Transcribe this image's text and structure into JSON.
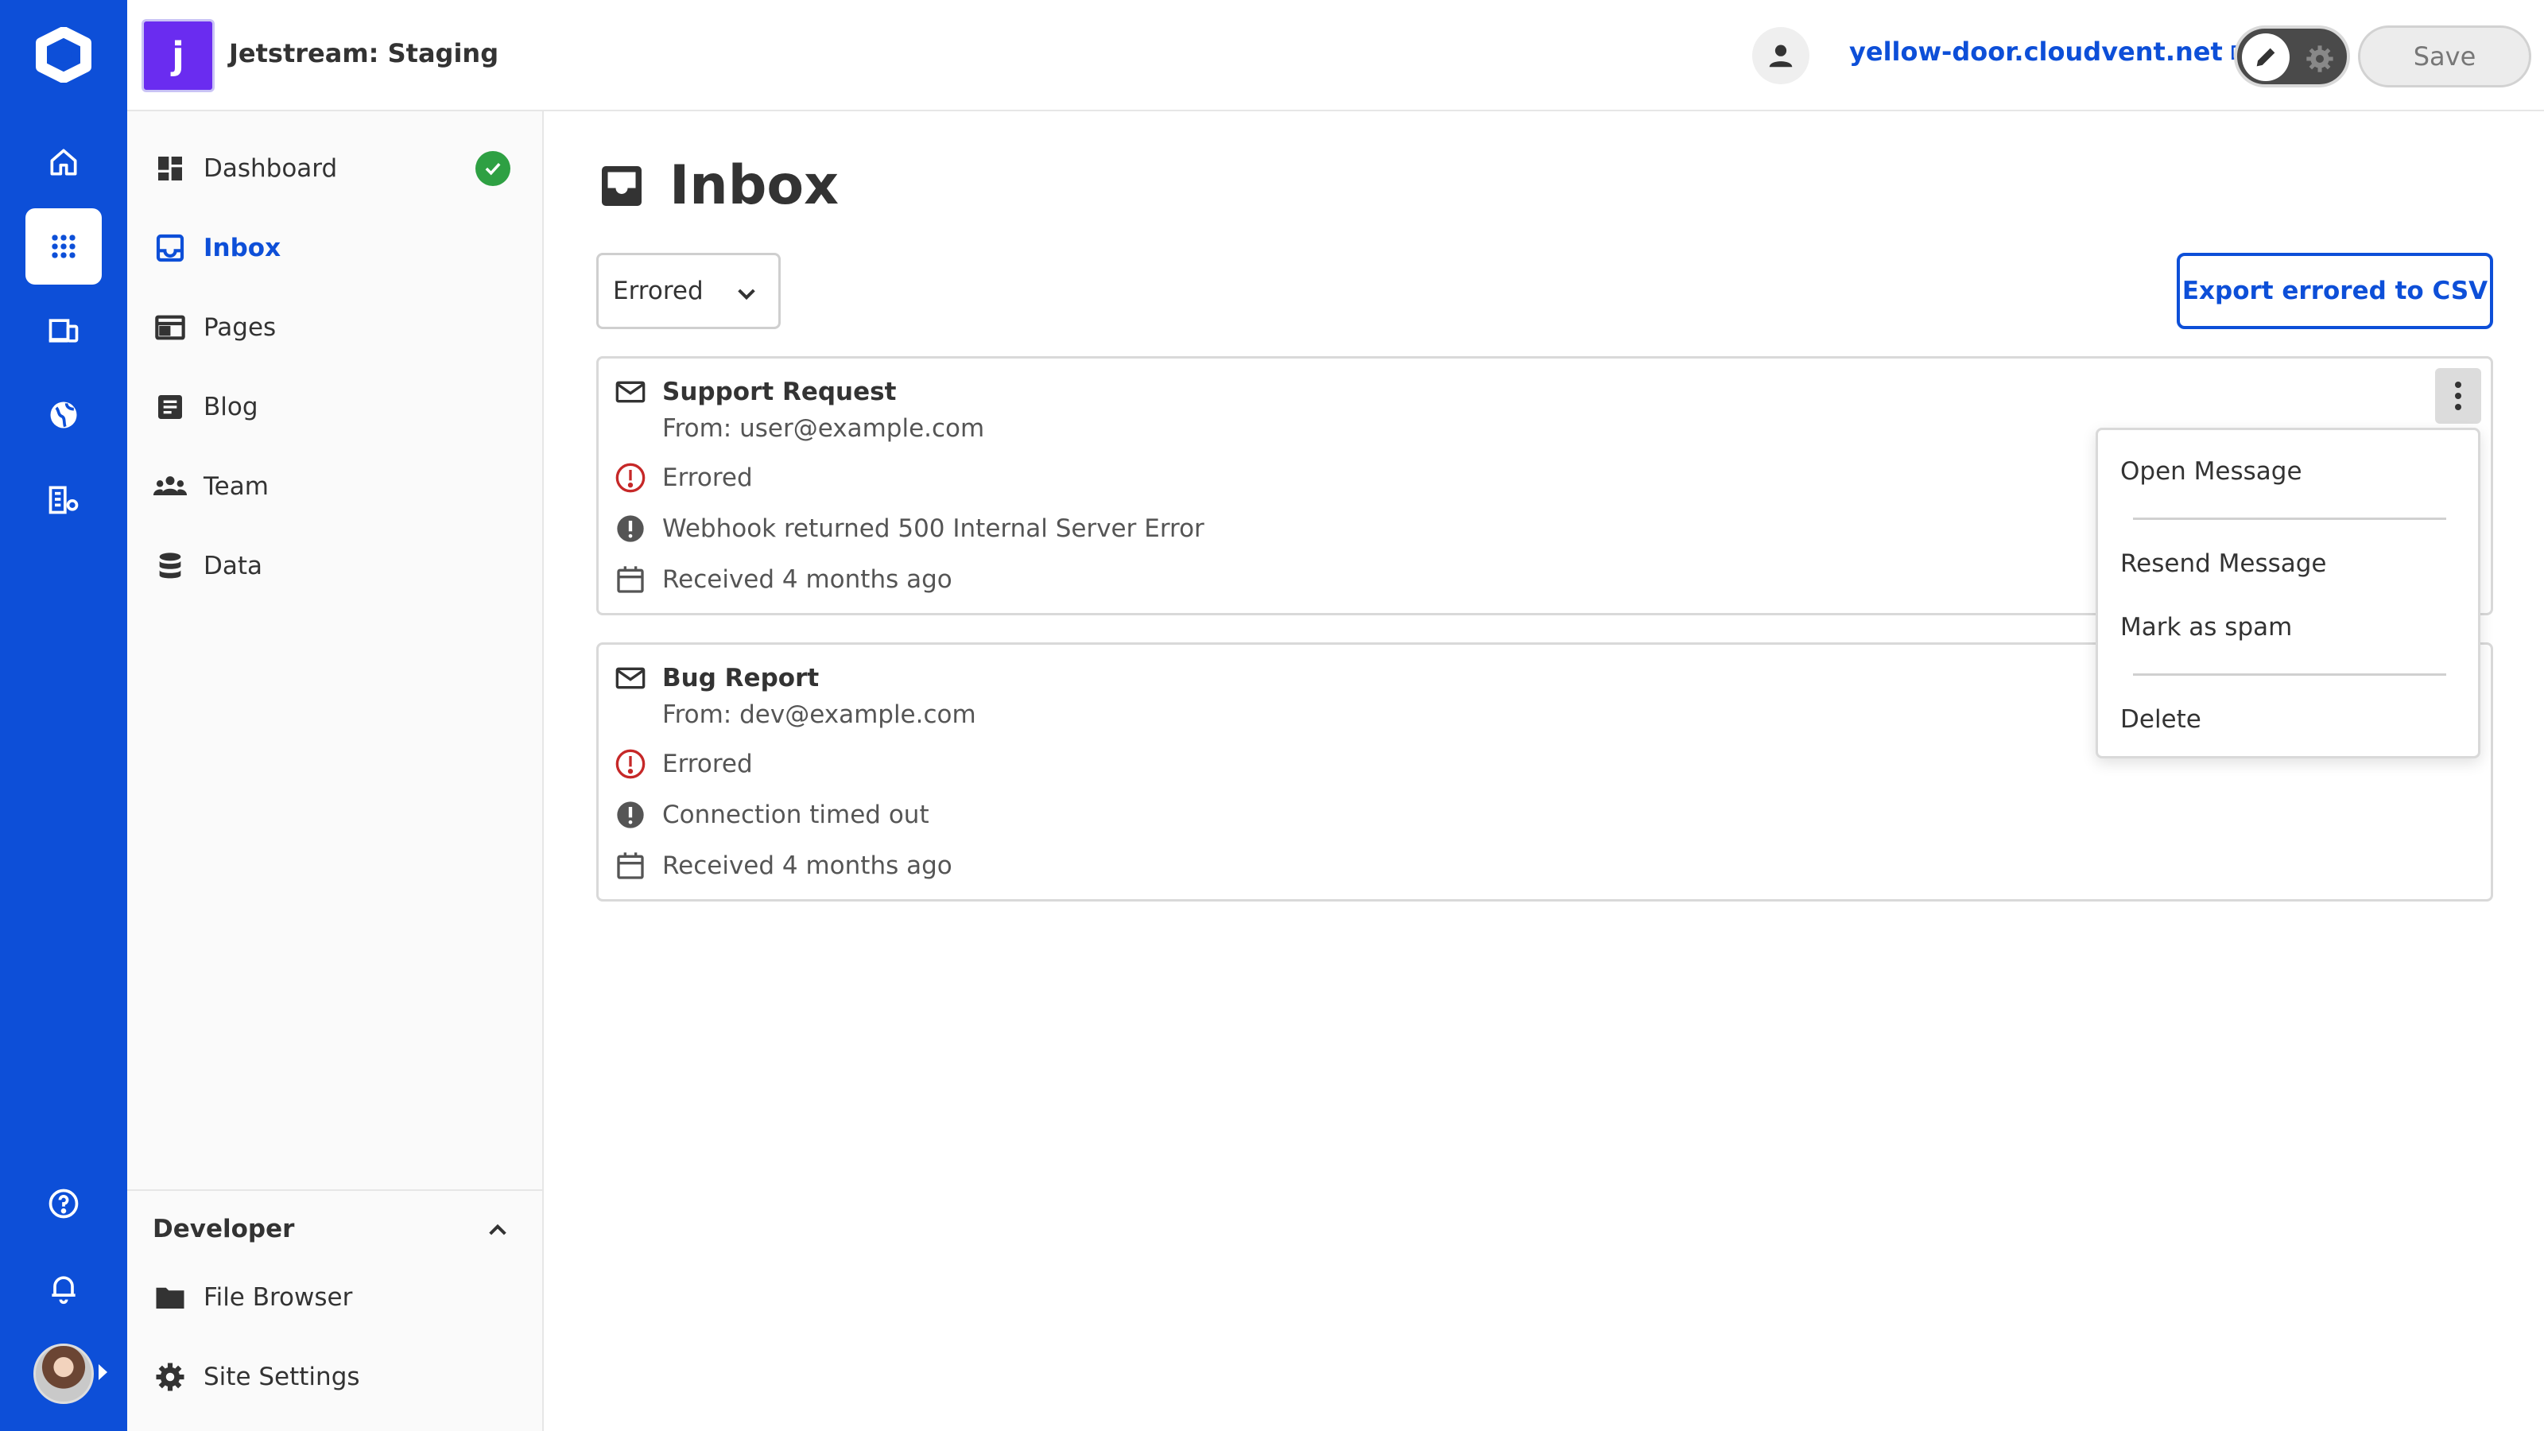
{
  "app": {
    "site_initial": "j",
    "site_name": "Jetstream: Staging",
    "domain": "yellow-door.cloudvent.net",
    "save_label": "Save",
    "accent_color": "#0d4fd8"
  },
  "rail": {
    "items": [
      "home-icon",
      "apps-grid-icon",
      "devices-icon",
      "globe-icon",
      "org-settings-icon"
    ],
    "active": "apps-grid-icon",
    "bottom": [
      "help-icon",
      "bell-icon",
      "avatar"
    ]
  },
  "sidebar": {
    "items": [
      {
        "label": "Dashboard",
        "icon": "dashboard-icon",
        "status": "ok"
      },
      {
        "label": "Inbox",
        "icon": "inbox-icon",
        "active": true
      },
      {
        "label": "Pages",
        "icon": "pages-icon"
      },
      {
        "label": "Blog",
        "icon": "blog-icon"
      },
      {
        "label": "Team",
        "icon": "team-icon"
      },
      {
        "label": "Data",
        "icon": "database-icon"
      }
    ],
    "developer": {
      "title": "Developer",
      "items": [
        {
          "label": "File Browser",
          "icon": "folder-icon"
        },
        {
          "label": "Site Settings",
          "icon": "gear-icon"
        }
      ]
    }
  },
  "main": {
    "title": "Inbox",
    "filter": {
      "selected": "Errored"
    },
    "export_label": "Export errored to CSV",
    "messages": [
      {
        "title": "Support Request",
        "from": "From: user@example.com",
        "status": "Errored",
        "error": "Webhook returned 500 Internal Server Error",
        "received": "Received 4 months ago"
      },
      {
        "title": "Bug Report",
        "from": "From: dev@example.com",
        "status": "Errored",
        "error": "Connection timed out",
        "received": "Received 4 months ago"
      }
    ],
    "menu": {
      "open": "Open Message",
      "resend": "Resend Message",
      "spam": "Mark as spam",
      "delete": "Delete"
    }
  }
}
